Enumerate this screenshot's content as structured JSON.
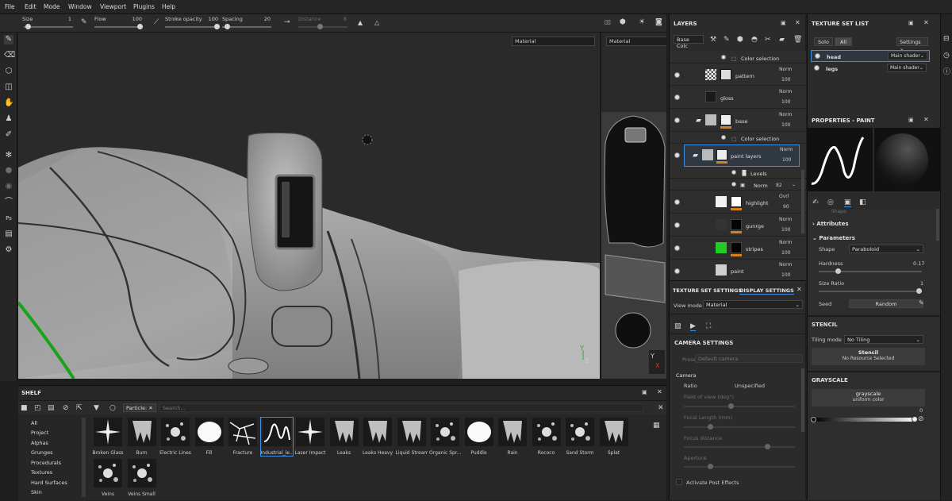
{
  "menu": [
    "File",
    "Edit",
    "Mode",
    "Window",
    "Viewport",
    "Plugins",
    "Help"
  ],
  "tool_options": {
    "size_label": "Size",
    "size_value": "1",
    "flow_label": "Flow",
    "flow_value": "100",
    "stroke_opacity_label": "Stroke opacity",
    "stroke_opacity_value": "100",
    "spacing_label": "Spacing",
    "spacing_value": "20",
    "distance_label": "Distance",
    "distance_value": "8"
  },
  "viewport": {
    "mode_3d": "Material",
    "mode_2d": "Material"
  },
  "layers": {
    "title": "LAYERS",
    "channel": "Base Colc",
    "rows": [
      {
        "name": "Color selection",
        "blend": "",
        "opacity": "",
        "kind": "effect"
      },
      {
        "name": "pattern",
        "blend": "Norm",
        "opacity": "100",
        "kind": "layer"
      },
      {
        "name": "gloss",
        "blend": "Norm",
        "opacity": "100",
        "kind": "layer"
      },
      {
        "name": "base",
        "blend": "Norm",
        "opacity": "100",
        "kind": "folder"
      },
      {
        "name": "Color selection",
        "blend": "",
        "opacity": "",
        "kind": "effect"
      },
      {
        "name": "paint layers",
        "blend": "Norm",
        "opacity": "100",
        "kind": "folder"
      },
      {
        "name": "Levels",
        "blend": "",
        "opacity": "",
        "kind": "effect"
      },
      {
        "name": "Norm",
        "blend": "",
        "opacity": "82",
        "kind": "effect"
      },
      {
        "name": "highlight",
        "blend": "Ovrl",
        "opacity": "90",
        "kind": "layer"
      },
      {
        "name": "gunrge",
        "blend": "Norm",
        "opacity": "100",
        "kind": "layer"
      },
      {
        "name": "stripes",
        "blend": "Norm",
        "opacity": "100",
        "kind": "layer"
      },
      {
        "name": "paint",
        "blend": "Norm",
        "opacity": "100",
        "kind": "layer"
      }
    ]
  },
  "texture_set_list": {
    "title": "TEXTURE SET LIST",
    "solo": "Solo",
    "all": "All",
    "settings": "Settings",
    "sets": [
      {
        "name": "head",
        "shader": "Main shader"
      },
      {
        "name": "legs",
        "shader": "Main shader"
      }
    ]
  },
  "properties": {
    "title": "PROPERTIES - PAINT",
    "shape_partial": "Shape",
    "attributes": "Attributes",
    "parameters": "Parameters",
    "shape_label": "Shape",
    "shape_value": "Paraboloid",
    "hardness_label": "Hardness",
    "hardness_value": "0.17",
    "size_ratio_label": "Size Ratio",
    "size_ratio_value": "1",
    "seed_label": "Seed",
    "seed_value": "Random",
    "stencil": "STENCIL",
    "tiling_label": "Tiling mode",
    "tiling_value": "No Tiling",
    "stencil_btn": "Stencil",
    "stencil_sub": "No Resource Selected",
    "grayscale": "GRAYSCALE",
    "gray_btn": "grayscale",
    "gray_sub": "uniform color",
    "gray_value": "0",
    "hardness_level": 0.17,
    "size_ratio_level": 1.0,
    "gray_level": 1.0
  },
  "display": {
    "tab1": "TEXTURE SET SETTINGS",
    "tab2": "DISPLAY SETTINGS",
    "view_mode_label": "View mode",
    "view_mode_value": "Material",
    "camera_settings": "CAMERA SETTINGS",
    "preset_label": "Preset",
    "preset_value": "Default camera",
    "camera": "Camera",
    "ratio_label": "Ratio",
    "ratio_value": "Unspecified",
    "fov": "Field of view (deg°)",
    "focal": "Focal Length (mm)",
    "focus": "Focus distance",
    "aperture": "Aperture",
    "post": "Activate Post Effects"
  },
  "shelf": {
    "title": "SHELF",
    "filter": "Particle:",
    "search_placeholder": "Search...",
    "categories": [
      "All",
      "Project",
      "Alphas",
      "Grunges",
      "Procedurals",
      "Textures",
      "Hard Surfaces",
      "Skin"
    ],
    "brushes": [
      "Broken Glass",
      "Burn",
      "Electric Lines",
      "Fill",
      "Fracture",
      "Industrial_le...",
      "Laser Impact",
      "Leaks",
      "Leaks Heavy",
      "Liquid Stream",
      "Organic Spr...",
      "Puddle",
      "Rain",
      "Rococo",
      "Sand Storm",
      "Splat",
      "Veins",
      "Veins Small"
    ]
  },
  "colors": {
    "accent": "#3d8ee0",
    "green": "#22cc22",
    "orange": "#d9801e"
  }
}
